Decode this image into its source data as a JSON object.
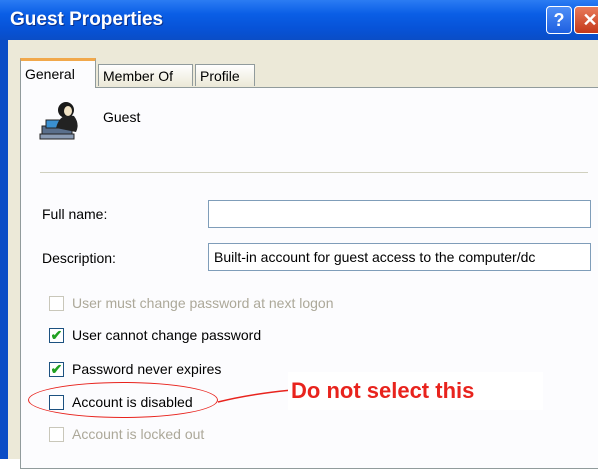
{
  "window": {
    "title": "Guest Properties"
  },
  "title_buttons": {
    "help": "?",
    "close": "✕"
  },
  "tabs": [
    "General",
    "Member Of",
    "Profile"
  ],
  "user": {
    "name": "Guest",
    "icon": "user-computer-icon"
  },
  "fields": {
    "full_name": {
      "label": "Full name:",
      "value": ""
    },
    "description": {
      "label": "Description:",
      "value": "Built-in account for guest access to the computer/dc"
    }
  },
  "checkboxes": [
    {
      "label": "User must change password at next logon",
      "checked": false,
      "disabled": true
    },
    {
      "label": "User cannot change password",
      "checked": true,
      "disabled": false
    },
    {
      "label": "Password never expires",
      "checked": true,
      "disabled": false
    },
    {
      "label": "Account is disabled",
      "checked": false,
      "disabled": false
    },
    {
      "label": "Account is locked out",
      "checked": false,
      "disabled": true
    }
  ],
  "annotation": {
    "text": "Do not select this",
    "color": "#e8231d"
  }
}
